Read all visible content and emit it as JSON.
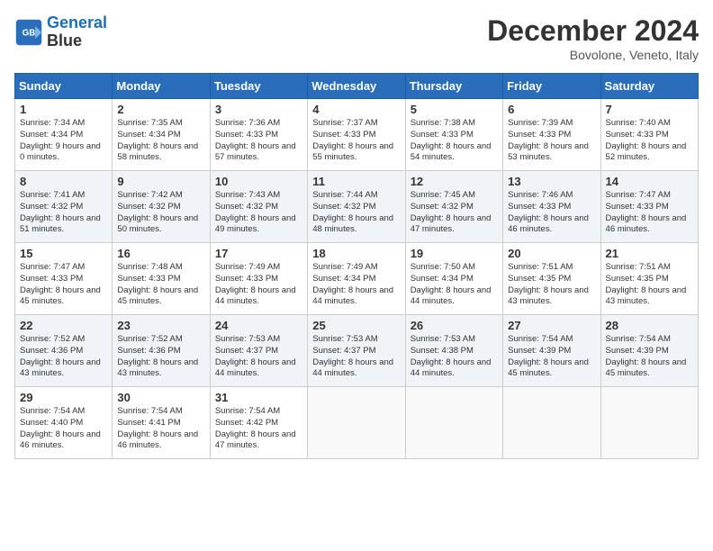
{
  "header": {
    "logo_line1": "General",
    "logo_line2": "Blue",
    "month": "December 2024",
    "location": "Bovolone, Veneto, Italy"
  },
  "weekdays": [
    "Sunday",
    "Monday",
    "Tuesday",
    "Wednesday",
    "Thursday",
    "Friday",
    "Saturday"
  ],
  "weeks": [
    [
      {
        "day": "1",
        "rise": "Sunrise: 7:34 AM",
        "set": "Sunset: 4:34 PM",
        "light": "Daylight: 9 hours and 0 minutes."
      },
      {
        "day": "2",
        "rise": "Sunrise: 7:35 AM",
        "set": "Sunset: 4:34 PM",
        "light": "Daylight: 8 hours and 58 minutes."
      },
      {
        "day": "3",
        "rise": "Sunrise: 7:36 AM",
        "set": "Sunset: 4:33 PM",
        "light": "Daylight: 8 hours and 57 minutes."
      },
      {
        "day": "4",
        "rise": "Sunrise: 7:37 AM",
        "set": "Sunset: 4:33 PM",
        "light": "Daylight: 8 hours and 55 minutes."
      },
      {
        "day": "5",
        "rise": "Sunrise: 7:38 AM",
        "set": "Sunset: 4:33 PM",
        "light": "Daylight: 8 hours and 54 minutes."
      },
      {
        "day": "6",
        "rise": "Sunrise: 7:39 AM",
        "set": "Sunset: 4:33 PM",
        "light": "Daylight: 8 hours and 53 minutes."
      },
      {
        "day": "7",
        "rise": "Sunrise: 7:40 AM",
        "set": "Sunset: 4:33 PM",
        "light": "Daylight: 8 hours and 52 minutes."
      }
    ],
    [
      {
        "day": "8",
        "rise": "Sunrise: 7:41 AM",
        "set": "Sunset: 4:32 PM",
        "light": "Daylight: 8 hours and 51 minutes."
      },
      {
        "day": "9",
        "rise": "Sunrise: 7:42 AM",
        "set": "Sunset: 4:32 PM",
        "light": "Daylight: 8 hours and 50 minutes."
      },
      {
        "day": "10",
        "rise": "Sunrise: 7:43 AM",
        "set": "Sunset: 4:32 PM",
        "light": "Daylight: 8 hours and 49 minutes."
      },
      {
        "day": "11",
        "rise": "Sunrise: 7:44 AM",
        "set": "Sunset: 4:32 PM",
        "light": "Daylight: 8 hours and 48 minutes."
      },
      {
        "day": "12",
        "rise": "Sunrise: 7:45 AM",
        "set": "Sunset: 4:32 PM",
        "light": "Daylight: 8 hours and 47 minutes."
      },
      {
        "day": "13",
        "rise": "Sunrise: 7:46 AM",
        "set": "Sunset: 4:33 PM",
        "light": "Daylight: 8 hours and 46 minutes."
      },
      {
        "day": "14",
        "rise": "Sunrise: 7:47 AM",
        "set": "Sunset: 4:33 PM",
        "light": "Daylight: 8 hours and 46 minutes."
      }
    ],
    [
      {
        "day": "15",
        "rise": "Sunrise: 7:47 AM",
        "set": "Sunset: 4:33 PM",
        "light": "Daylight: 8 hours and 45 minutes."
      },
      {
        "day": "16",
        "rise": "Sunrise: 7:48 AM",
        "set": "Sunset: 4:33 PM",
        "light": "Daylight: 8 hours and 45 minutes."
      },
      {
        "day": "17",
        "rise": "Sunrise: 7:49 AM",
        "set": "Sunset: 4:33 PM",
        "light": "Daylight: 8 hours and 44 minutes."
      },
      {
        "day": "18",
        "rise": "Sunrise: 7:49 AM",
        "set": "Sunset: 4:34 PM",
        "light": "Daylight: 8 hours and 44 minutes."
      },
      {
        "day": "19",
        "rise": "Sunrise: 7:50 AM",
        "set": "Sunset: 4:34 PM",
        "light": "Daylight: 8 hours and 44 minutes."
      },
      {
        "day": "20",
        "rise": "Sunrise: 7:51 AM",
        "set": "Sunset: 4:35 PM",
        "light": "Daylight: 8 hours and 43 minutes."
      },
      {
        "day": "21",
        "rise": "Sunrise: 7:51 AM",
        "set": "Sunset: 4:35 PM",
        "light": "Daylight: 8 hours and 43 minutes."
      }
    ],
    [
      {
        "day": "22",
        "rise": "Sunrise: 7:52 AM",
        "set": "Sunset: 4:36 PM",
        "light": "Daylight: 8 hours and 43 minutes."
      },
      {
        "day": "23",
        "rise": "Sunrise: 7:52 AM",
        "set": "Sunset: 4:36 PM",
        "light": "Daylight: 8 hours and 43 minutes."
      },
      {
        "day": "24",
        "rise": "Sunrise: 7:53 AM",
        "set": "Sunset: 4:37 PM",
        "light": "Daylight: 8 hours and 44 minutes."
      },
      {
        "day": "25",
        "rise": "Sunrise: 7:53 AM",
        "set": "Sunset: 4:37 PM",
        "light": "Daylight: 8 hours and 44 minutes."
      },
      {
        "day": "26",
        "rise": "Sunrise: 7:53 AM",
        "set": "Sunset: 4:38 PM",
        "light": "Daylight: 8 hours and 44 minutes."
      },
      {
        "day": "27",
        "rise": "Sunrise: 7:54 AM",
        "set": "Sunset: 4:39 PM",
        "light": "Daylight: 8 hours and 45 minutes."
      },
      {
        "day": "28",
        "rise": "Sunrise: 7:54 AM",
        "set": "Sunset: 4:39 PM",
        "light": "Daylight: 8 hours and 45 minutes."
      }
    ],
    [
      {
        "day": "29",
        "rise": "Sunrise: 7:54 AM",
        "set": "Sunset: 4:40 PM",
        "light": "Daylight: 8 hours and 46 minutes."
      },
      {
        "day": "30",
        "rise": "Sunrise: 7:54 AM",
        "set": "Sunset: 4:41 PM",
        "light": "Daylight: 8 hours and 46 minutes."
      },
      {
        "day": "31",
        "rise": "Sunrise: 7:54 AM",
        "set": "Sunset: 4:42 PM",
        "light": "Daylight: 8 hours and 47 minutes."
      },
      null,
      null,
      null,
      null
    ]
  ]
}
